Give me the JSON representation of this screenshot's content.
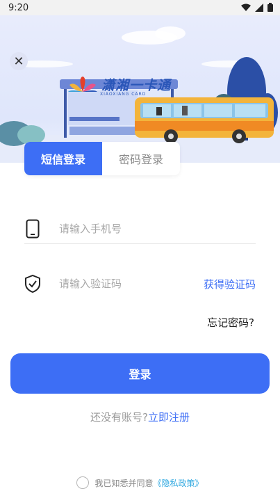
{
  "status_bar": {
    "time": "9:20"
  },
  "banner": {
    "logo_text": "潇湘一卡通",
    "logo_subtext": "XIAOXIANG CARD"
  },
  "tabs": [
    {
      "label": "短信登录",
      "active": true
    },
    {
      "label": "密码登录",
      "active": false
    }
  ],
  "phone": {
    "placeholder": "请输入手机号",
    "value": ""
  },
  "code": {
    "placeholder": "请输入验证码",
    "value": "",
    "get_code_label": "获得验证码"
  },
  "forgot_password": "忘记密码?",
  "login_label": "登录",
  "register": {
    "question": "还没有账号?",
    "link": "立即注册"
  },
  "agreement": {
    "text": "我已知悉并同意",
    "policy": "《隐私政策》"
  },
  "colors": {
    "accent": "#3d6ef5",
    "link": "#2fa8e0"
  }
}
